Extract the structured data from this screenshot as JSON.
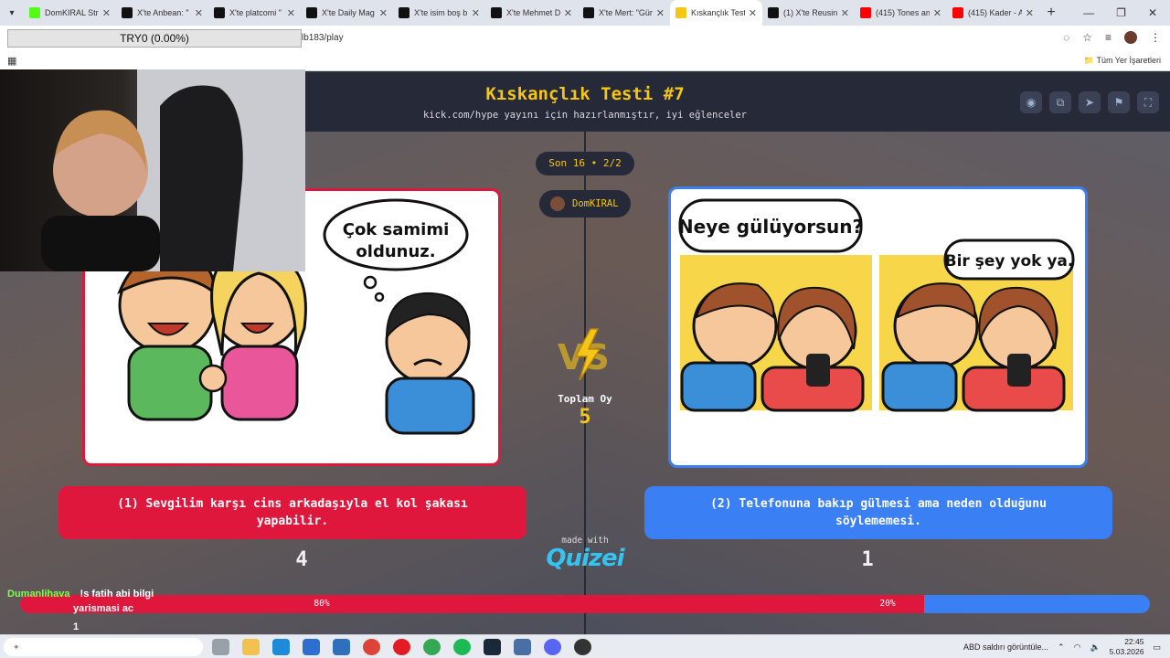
{
  "browser": {
    "tabs": [
      {
        "label": "DomKIRAL Stre",
        "color": "#53fc18"
      },
      {
        "label": "X'te Anbean: \"",
        "color": "#111111"
      },
      {
        "label": "X'te platcomi \"",
        "color": "#111111"
      },
      {
        "label": "X'te Daily Mag",
        "color": "#111111"
      },
      {
        "label": "X'te isim boş b",
        "color": "#111111"
      },
      {
        "label": "X'te Mehmet D",
        "color": "#111111"
      },
      {
        "label": "X'te Mert: \"Gür",
        "color": "#111111"
      },
      {
        "label": "Kıskançlık Testi",
        "color": "#f5c518",
        "active": true
      },
      {
        "label": "(1) X'te Reusin",
        "color": "#111111"
      },
      {
        "label": "(415) Tones an",
        "color": "#ff0000"
      },
      {
        "label": "(415) Kader - A",
        "color": "#ff0000"
      }
    ],
    "url": "lb183/play",
    "bookmarks_all": "Tüm Yer İşaretleri",
    "overlay_label": "TRY0 (0.00%)"
  },
  "quiz": {
    "title": "Kıskançlık Testi #7",
    "subtitle": "kick.com/hype yayını için hazırlanmıştır, iyi eğlenceler",
    "round": "Son 16 • 2/2",
    "user": "DomKIRAL",
    "total_label": "Toplam Oy",
    "total_value": "5",
    "left": {
      "caption": "(1) Sevgilim karşı cins arkadaşıyla el kol şakası yapabilir.",
      "bubble": [
        "Çok samimi",
        "oldunuz."
      ],
      "votes": "4",
      "percent": "80%",
      "fraction": 0.8
    },
    "right": {
      "caption": "(2) Telefonuna bakıp gülmesi ama neden olduğunu söylememesi.",
      "bubble1": "Neye gülüyorsun?",
      "bubble2": "Bir şey yok ya.",
      "votes": "1",
      "percent": "20%"
    },
    "made_with": "made with",
    "brand": "Quizei"
  },
  "chat": [
    {
      "user": "Dumanlihava",
      "text": "!s fatih abi bilgi",
      "cont": "yarismasi ac",
      "color": "#7cff4a"
    },
    {
      "user": "",
      "text": "1",
      "color": "#2f6cff"
    }
  ],
  "taskbar": {
    "news": "ABD saldırı görüntüle...",
    "time": "22:45",
    "date": "5.03.2026"
  },
  "colors": {
    "accent": "#f5c518",
    "left": "#e0173c",
    "right": "#3b7ff5"
  }
}
